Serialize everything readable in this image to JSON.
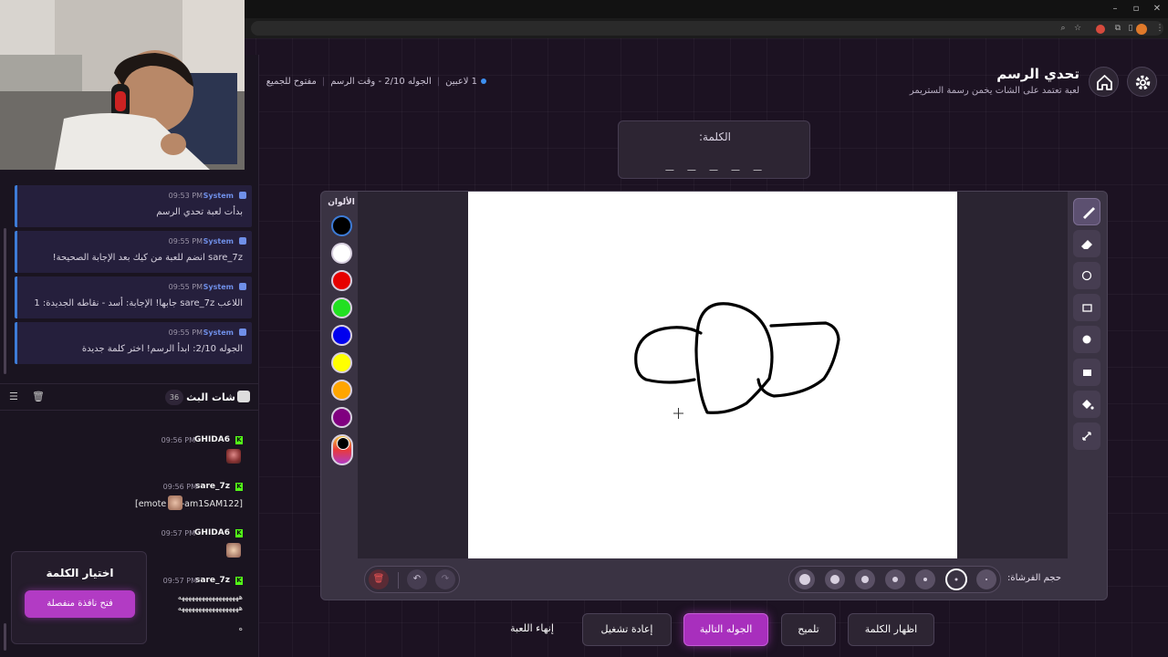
{
  "app": {
    "title": "تحدي الرسم",
    "subtitle": "لعبة تعتمد على الشات يخمن رسمة الستريمر",
    "status": {
      "players": "1 لاعبين",
      "round": "الجوله 2/10 - وقت الرسم",
      "mode": "مفتوح للجميع"
    }
  },
  "word": {
    "label": "الكلمة:",
    "blanks": "_ _ _ _ _"
  },
  "colors": {
    "label": "الألوان",
    "swatches": [
      "#000000",
      "#ffffff",
      "#e60000",
      "#22e022",
      "#0000ee",
      "#ffff00",
      "#ffa500",
      "#800080"
    ]
  },
  "tools": [
    "brush-icon",
    "eraser-icon",
    "circle-icon",
    "rectangle-icon",
    "filled-circle-icon",
    "filled-rectangle-icon",
    "fill-bucket-icon",
    "line-icon"
  ],
  "brush": {
    "label": "حجم الفرشاة:",
    "selected_index": 1
  },
  "system_messages": [
    {
      "author": "System",
      "time": "09:53 PM",
      "text": "بدأت لعبة تحدي الرسم"
    },
    {
      "author": "System",
      "time": "09:55 PM",
      "text": "sare_7z انضم للعبة من كيك بعد الإجابة الصحيحة!"
    },
    {
      "author": "System",
      "time": "09:55 PM",
      "text": "اللاعب sare_7z جابها! الإجابة: أسد - نقاطه الجديدة: 1"
    },
    {
      "author": "System",
      "time": "09:55 PM",
      "text": "الجوله 2/10: ابدأ الرسم! اختر كلمة جديدة"
    }
  ],
  "chat": {
    "title": "شات البث",
    "count": "36",
    "messages": [
      {
        "author": "GHIDA6",
        "time": "09:56 PM",
        "text": ""
      },
      {
        "author": "sare_7z",
        "time": "09:56 PM",
        "text_pre": "[emote",
        "text_post": "s-am1SAM122]"
      },
      {
        "author": "GHIDA6",
        "time": "09:57 PM",
        "text": ""
      },
      {
        "author": "sare_7z",
        "time": "09:57 PM",
        "text": "ههههههههههههههههههه",
        "text2": "ههههههههههههههههههه",
        "text3": "ه"
      }
    ]
  },
  "word_widget": {
    "title": "اختيار الكلمة",
    "button": "فتح نافذة منفصلة"
  },
  "actions": {
    "reveal": "اظهار الكلمة",
    "hint": "تلميح",
    "next_round": "الجوله التالية",
    "restart": "إعادة تشغيل",
    "end_game": "إنهاء اللعبة"
  },
  "accent": "#b23bc4"
}
